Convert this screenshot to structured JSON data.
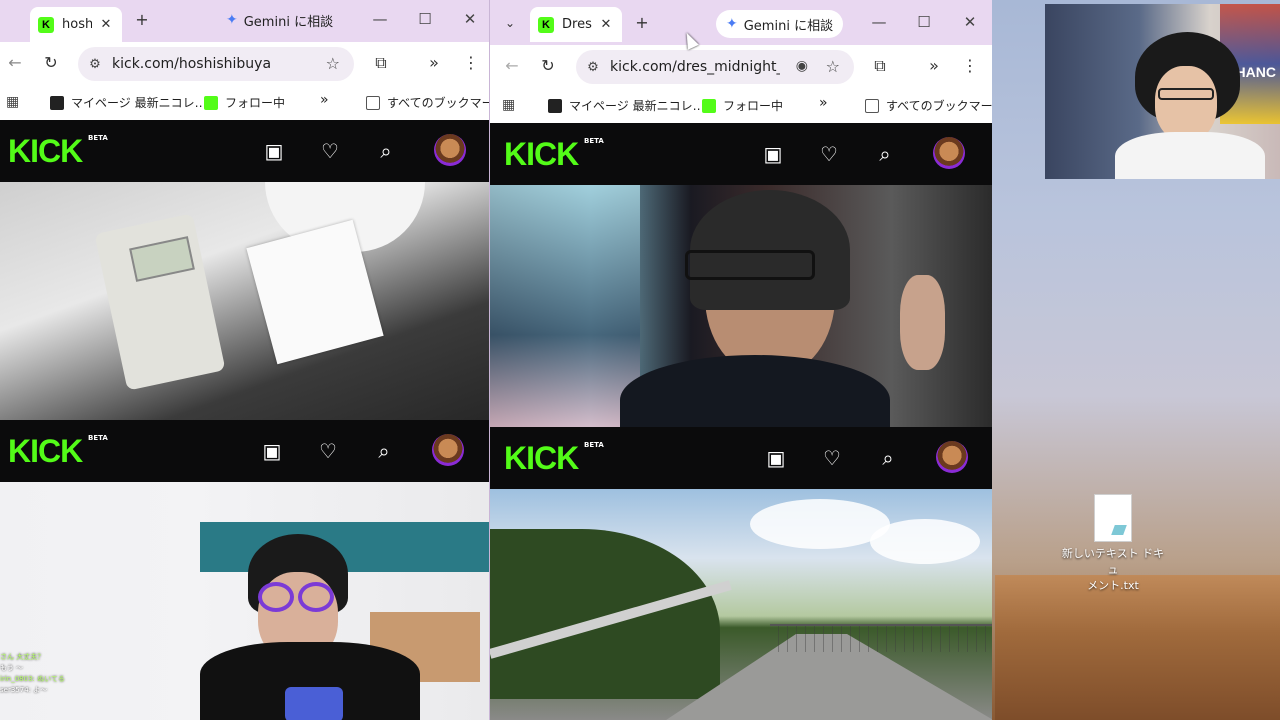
{
  "desktop": {
    "file_name_line1": "新しいテキスト ドキュ",
    "file_name_line2": "メント.txt",
    "webcam_poster_text": "CHANC"
  },
  "window_left": {
    "tab_title": "hosh",
    "tab_close": "✕",
    "new_tab": "+",
    "gemini_label": "Gemini に相談",
    "url": "kick.com/hoshishibuya",
    "bookmarks": [
      {
        "label": "マイページ 最新ニコレ…",
        "icon": "tv-icon"
      },
      {
        "label": "フォロー中",
        "icon": "kick-icon"
      }
    ],
    "bookmarks_overflow": "»",
    "all_bookmarks": "すべてのブックマーク"
  },
  "window_right": {
    "tab_title": "Dres",
    "tab_close": "✕",
    "new_tab": "+",
    "gemini_label": "Gemini に相談",
    "url": "kick.com/dres_midnight_...",
    "bookmarks": [
      {
        "label": "マイページ 最新ニコレ…",
        "icon": "tv-icon"
      },
      {
        "label": "フォロー中",
        "icon": "kick-icon"
      }
    ],
    "bookmarks_overflow": "»",
    "all_bookmarks": "すべてのブックマーク"
  },
  "kick": {
    "logo": "KICK",
    "beta": "BETA",
    "accent_color": "#53fc18"
  },
  "chat_overlay": [
    "さん 大丈夫？",
    "もう 〜",
    "irin_0803: ぬいてる",
    "ser3574: よ〜"
  ]
}
